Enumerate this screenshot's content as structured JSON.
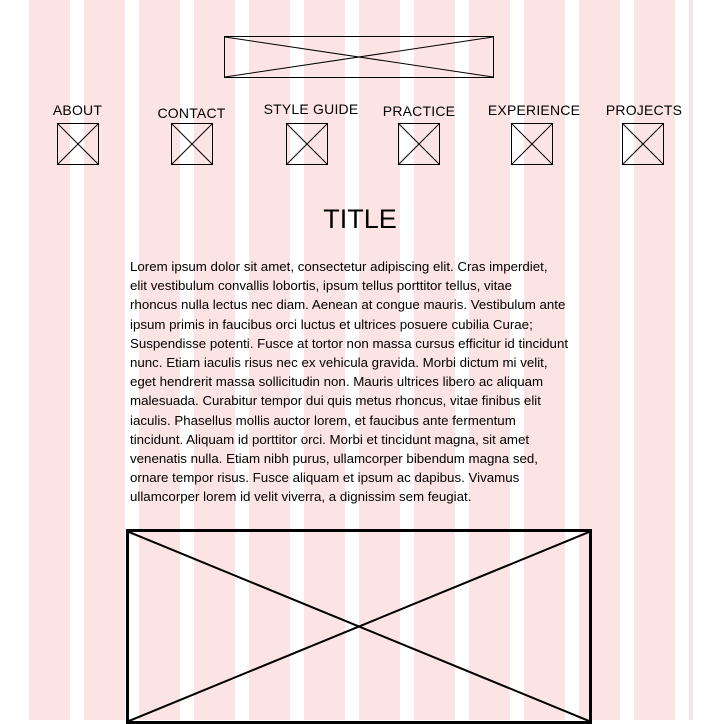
{
  "nav": {
    "items": [
      {
        "label": "ABOUT"
      },
      {
        "label": "CONTACT"
      },
      {
        "label": "STYLE GUIDE"
      },
      {
        "label": "PRACTICE"
      },
      {
        "label": "EXPERIENCE"
      },
      {
        "label": "PROJECTS"
      }
    ]
  },
  "content": {
    "title": "TITLE",
    "body": "Lorem ipsum dolor sit amet, consectetur adipiscing elit. Cras imperdiet,\nelit vestibulum convallis lobortis, ipsum tellus porttitor tellus, vitae\nrhoncus nulla lectus nec diam. Aenean at congue mauris. Vestibulum ante\nipsum primis in faucibus orci luctus et ultrices posuere cubilia Curae;\nSuspendisse potenti. Fusce at tortor non massa cursus efficitur id tincidunt\nnunc. Etiam iaculis risus nec ex vehicula gravida. Morbi dictum mi velit,\neget hendrerit massa sollicitudin non. Mauris ultrices libero ac aliquam\nmalesuada. Curabitur tempor dui quis metus rhoncus, vitae finibus elit\niaculis. Phasellus mollis auctor lorem, et faucibus ante fermentum\ntincidunt. Aliquam id porttitor orci. Morbi et tincidunt magna, sit amet\nvenenatis nulla. Etiam nibh purus, ullamcorper bibendum magna sed,\nornare tempor risus. Fusce aliquam et ipsum ac dapibus. Vivamus\nullamcorper lorem id velit viverra, a dignissim sem feugiat."
  },
  "colors": {
    "grid_column": "#fde4e4",
    "background": "#ffffff",
    "stroke": "#000000"
  }
}
